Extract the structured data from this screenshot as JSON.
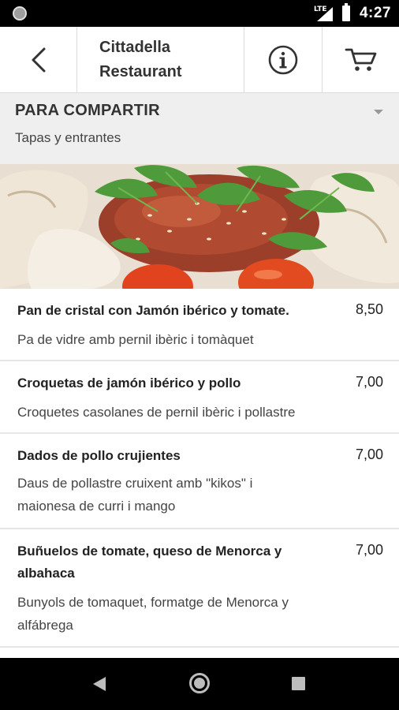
{
  "status_bar": {
    "network": "LTE",
    "time": "4:27"
  },
  "app_bar": {
    "title": "Cittadella Restaurant",
    "back_icon": "chevron-left-icon",
    "info_icon": "info-icon",
    "cart_icon": "cart-icon"
  },
  "section": {
    "title": "PARA COMPARTIR",
    "subtitle": "Tapas y entrantes"
  },
  "menu_items": [
    {
      "name": "Pan de cristal con Jamón ibérico y tomate.",
      "price": "8,50",
      "description": "Pa de vidre amb pernil ibèric i tomàquet"
    },
    {
      "name": "Croquetas de jamón ibérico y pollo",
      "price": "7,00",
      "description": "Croquetes casolanes de pernil ibèric i pollastre"
    },
    {
      "name": "Dados de pollo crujientes",
      "price": "7,00",
      "description": "Daus de pollastre cruixent amb \"kikos\" i maionesa de curri i mango"
    },
    {
      "name": "Buñuelos de tomate, queso de Menorca y albahaca",
      "price": "7,00",
      "description": "Bunyols de tomaquet, formatge de Menorca y alfábrega"
    }
  ],
  "colors": {
    "status_bar": "#000000",
    "section_bg": "#efefef",
    "divider": "#dcdcdc",
    "text": "#222222"
  }
}
